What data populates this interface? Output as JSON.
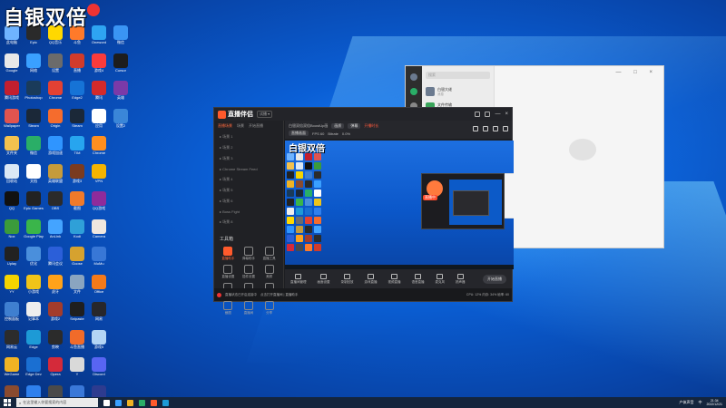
{
  "overlay": {
    "watermark": "自银双倍"
  },
  "desktop_icons": [
    {
      "label": "此电脑",
      "color": "#6fb3ff"
    },
    {
      "label": "Google",
      "color": "#e8e8e8"
    },
    {
      "label": "腾讯游戏",
      "color": "#c21f2f"
    },
    {
      "label": "Wallpaper",
      "color": "#e0544f"
    },
    {
      "label": "文件夹",
      "color": "#f2c14e"
    },
    {
      "label": "回收站",
      "color": "#dbe8f5"
    },
    {
      "label": "QQ",
      "color": "#111111"
    },
    {
      "label": "Nox",
      "color": "#3b9b3b"
    },
    {
      "label": "Uplay",
      "color": "#222222"
    },
    {
      "label": "YY",
      "color": "#f5d400"
    },
    {
      "label": "控制面板",
      "color": "#3f7fd0"
    },
    {
      "label": "网易云",
      "color": "#2c2c2c"
    },
    {
      "label": "WeGame",
      "color": "#f0b324"
    },
    {
      "label": "游戏",
      "color": "#8a4b2f"
    },
    {
      "label": "Epic",
      "color": "#2a2a2a"
    },
    {
      "label": "网络",
      "color": "#3aa0ff"
    },
    {
      "label": "Photoshop",
      "color": "#1a3b5a"
    },
    {
      "label": "Steam",
      "color": "#1b2838"
    },
    {
      "label": "微信",
      "color": "#2aae67"
    },
    {
      "label": "文档",
      "color": "#ffffff"
    },
    {
      "label": "Epic Games",
      "color": "#222222"
    },
    {
      "label": "Google Play",
      "color": "#3ab54a"
    },
    {
      "label": "优化",
      "color": "#4a8fdc"
    },
    {
      "label": "小游戏",
      "color": "#f0c419"
    },
    {
      "label": "记事本",
      "color": "#eeeeee"
    },
    {
      "label": "Edge",
      "color": "#1d9ad6"
    },
    {
      "label": "Edge Dev",
      "color": "#1a6fd2"
    },
    {
      "label": "企业微信",
      "color": "#2f80ed"
    },
    {
      "label": "QQ音乐",
      "color": "#ffd800"
    },
    {
      "label": "设置",
      "color": "#6b6b6b"
    },
    {
      "label": "Chrome",
      "color": "#e34133"
    },
    {
      "label": "Origin",
      "color": "#f56c2d"
    },
    {
      "label": "游戏加速",
      "color": "#2f95ff"
    },
    {
      "label": "英雄联盟",
      "color": "#c59b3b"
    },
    {
      "label": "OBS",
      "color": "#2b2b2b"
    },
    {
      "label": "AnLink",
      "color": "#44a4ff"
    },
    {
      "label": "腾讯会议",
      "color": "#2b5fd9"
    },
    {
      "label": "虎牙",
      "color": "#ffa21a"
    },
    {
      "label": "游戏2",
      "color": "#a33c2c"
    },
    {
      "label": "剪映",
      "color": "#2b2b2b"
    },
    {
      "label": "Opera",
      "color": "#d42a3a"
    },
    {
      "label": "OBS Studio",
      "color": "#4a4a4a"
    },
    {
      "label": "斗鱼",
      "color": "#ff7a2a"
    },
    {
      "label": "直播",
      "color": "#d03b2b"
    },
    {
      "label": "Edge2",
      "color": "#1673d6"
    },
    {
      "label": "Steam",
      "color": "#1b2838"
    },
    {
      "label": "TIM",
      "color": "#27a5ef"
    },
    {
      "label": "游戏3",
      "color": "#7a3b1f"
    },
    {
      "label": "截图",
      "color": "#f07a2a"
    },
    {
      "label": "Kodi",
      "color": "#2fa0d8"
    },
    {
      "label": "Goose",
      "color": "#d6a22f"
    },
    {
      "label": "文件",
      "color": "#8aa5c0"
    },
    {
      "label": "Snipaste",
      "color": "#1f1f1f"
    },
    {
      "label": "斗鱼直播",
      "color": "#f16b2a"
    },
    {
      "label": "Y",
      "color": "#d9d9d9"
    },
    {
      "label": "App",
      "color": "#3a78d8"
    },
    {
      "label": "Oneword",
      "color": "#2ea4f2"
    },
    {
      "label": "游戏4",
      "color": "#fa3b3b"
    },
    {
      "label": "腾讯",
      "color": "#d32a2a"
    },
    {
      "label": "应用",
      "color": "#ffffff"
    },
    {
      "label": "Chrome",
      "color": "#ff8f1f"
    },
    {
      "label": "VPN",
      "color": "#f5b400"
    },
    {
      "label": "QQ游戏",
      "color": "#8e2b9b"
    },
    {
      "label": "Camera",
      "color": "#efe7df"
    },
    {
      "label": "MuMu",
      "color": "#3877d6"
    },
    {
      "label": "Office",
      "color": "#f57a1a"
    },
    {
      "label": "网易",
      "color": "#27272b"
    },
    {
      "label": "游戏5",
      "color": "#b3d5f5"
    },
    {
      "label": "Discord",
      "color": "#5865f2"
    },
    {
      "label": "存储",
      "color": "#2d3b8f"
    },
    {
      "label": "微信",
      "color": "#3a95f4"
    },
    {
      "label": "Cursor",
      "color": "#1d1d1d"
    },
    {
      "label": "英雄",
      "color": "#7a3aa8"
    },
    {
      "label": "设置2",
      "color": "#3a86d8"
    }
  ],
  "live_app": {
    "brand": "直播伴侣",
    "tag": "试播 ▾",
    "left_tabs": [
      "直播场景",
      "场景",
      "开始直播"
    ],
    "scenes": [
      "场景 1",
      "场景 2",
      "场景 3",
      "Chrome Stream Feed",
      "场景 4",
      "场景 5",
      "场景 6",
      "Boss Fight",
      "场景 8"
    ],
    "tools_title": "工具箱",
    "tools": [
      {
        "label": "直播助手",
        "hot": true
      },
      {
        "label": "弹幕助手",
        "hot": false
      },
      {
        "label": "直播工具",
        "hot": false
      },
      {
        "label": "直播设置",
        "hot": false
      },
      {
        "label": "插件设置",
        "hot": false
      },
      {
        "label": "美颜",
        "hot": false
      },
      {
        "label": "音乐",
        "hot": false
      },
      {
        "label": "相册",
        "hot": false
      },
      {
        "label": "更多",
        "hot": false
      },
      {
        "label": "截图",
        "hot": false
      },
      {
        "label": "直播间",
        "hot": false
      },
      {
        "label": "分享",
        "hot": false
      }
    ],
    "top_row1": [
      "白银双倍双倍BoostUp画",
      "画质",
      "弹幕",
      "标签",
      "开播时长"
    ],
    "top_row2": [
      "直播画面",
      "FPS 60",
      "Bitrate",
      "0.0%"
    ],
    "preview_watermark": "白银双倍",
    "preview_badge": "直播中",
    "bottom_items": [
      "直播间管理",
      "画面设置",
      "录制回放",
      "游戏直播",
      "视频直播",
      "语音直播",
      "麦克风",
      "扬声器"
    ],
    "start_button": "开始直播",
    "status_left": "直播状态已开启连接中",
    "status_mid": "点击打开直播间 | 直播助手",
    "status_right": "CPU: 12% 内存: 34% 帧率: 60"
  },
  "chat_window": {
    "search_placeholder": "搜索",
    "items": [
      {
        "name": "白银大佬",
        "msg": "消息",
        "avatar_color": "#6b7a8f"
      },
      {
        "name": "文件传输",
        "msg": "消息",
        "avatar_color": "#3aa55b"
      }
    ],
    "controls": "— □ ×"
  },
  "taskbar": {
    "search_placeholder": "在这里输入你要搜索的内容",
    "apps": [
      "#ffffff",
      "#3aa0ff",
      "#f0b324",
      "#2aae67",
      "#ff5a2c",
      "#1d9ad6"
    ],
    "tray_text": "产体声音",
    "tray_lang": "中",
    "time": "21:34",
    "date": "2022/12/21"
  }
}
